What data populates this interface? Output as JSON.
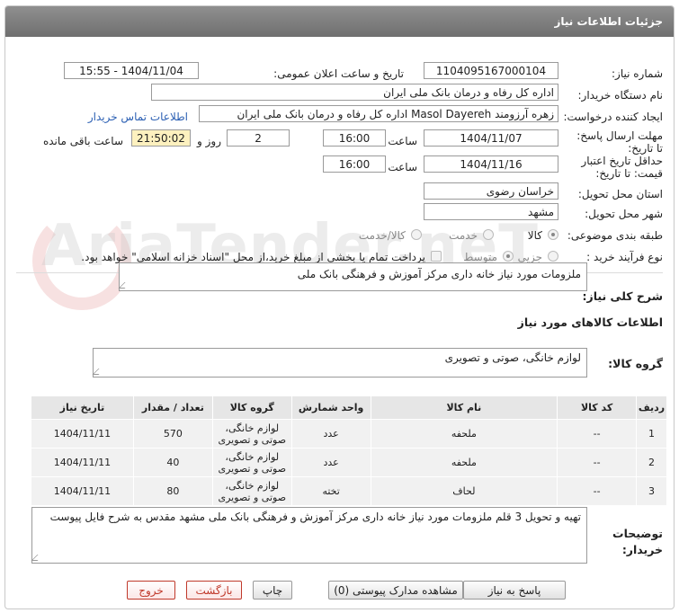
{
  "window": {
    "title": "جزئیات اطلاعات نیاز"
  },
  "watermark": {
    "text": "AriaTender.neT"
  },
  "form": {
    "need_number": {
      "label": "شماره نیاز:",
      "value": "1104095167000104"
    },
    "announce": {
      "label": "تاریخ و ساعت اعلان عمومی:",
      "value": "1404/11/04 - 15:55"
    },
    "buyer_org": {
      "label": "نام دستگاه خریدار:",
      "value": "اداره کل رفاه و درمان بانک ملی ایران"
    },
    "requester": {
      "label": "ایجاد کننده درخواست:",
      "value": "زهره آرزومند Masol Dayereh اداره کل رفاه و درمان بانک ملی ایران",
      "contact_link": "اطلاعات تماس خریدار"
    },
    "deadline": {
      "label": "مهلت ارسال پاسخ: تا تاریخ:",
      "date": "1404/11/07",
      "time_label": "ساعت",
      "time": "16:00",
      "days": "2",
      "days_label": "روز و",
      "remaining": "21:50:02",
      "remaining_label": "ساعت باقی مانده"
    },
    "validity": {
      "label": "حداقل تاریخ اعتبار قیمت: تا تاریخ:",
      "date": "1404/11/16",
      "time_label": "ساعت",
      "time": "16:00"
    },
    "province": {
      "label": "استان محل تحویل:",
      "value": "خراسان رضوی"
    },
    "city": {
      "label": "شهر محل تحویل:",
      "value": "مشهد"
    },
    "category": {
      "label": "طبقه بندی موضوعی:",
      "options": [
        "کالا",
        "خدمت",
        "کالا/خدمت"
      ],
      "selected": "کالا"
    },
    "purchase_type": {
      "label": "نوع فرآیند خرید :",
      "options": [
        "جزیی",
        "متوسط"
      ],
      "selected": "جزیی",
      "note": "پرداخت تمام یا بخشی از مبلغ خرید،از محل \"اسناد خزانه اسلامی\" خواهد بود."
    }
  },
  "summary": {
    "label": "شرح کلی نیاز:",
    "value": "ملزومات مورد نیاز خانه داری مرکز آموزش و فرهنگی بانک ملی"
  },
  "goods_section": {
    "title": "اطلاعات کالاهای مورد نیاز"
  },
  "goods_group": {
    "label": "گروه کالا:",
    "value": "لوازم خانگی، صوتی و تصویری"
  },
  "table": {
    "headers": [
      "ردیف",
      "کد کالا",
      "نام کالا",
      "واحد شمارش",
      "گروه کالا",
      "تعداد / مقدار",
      "تاریخ نیاز"
    ],
    "rows": [
      [
        "1",
        "--",
        "ملحفه",
        "عدد",
        "لوازم خانگی، صوتی و تصویری",
        "570",
        "1404/11/11"
      ],
      [
        "2",
        "--",
        "ملحفه",
        "عدد",
        "لوازم خانگی، صوتی و تصویری",
        "40",
        "1404/11/11"
      ],
      [
        "3",
        "--",
        "لحاف",
        "تخته",
        "لوازم خانگی، صوتی و تصویری",
        "80",
        "1404/11/11"
      ]
    ]
  },
  "buyer_notes": {
    "label": "توضیحات خریدار:",
    "value": "تهیه و تحویل 3 قلم ملزومات مورد نیاز خانه داری مرکز آموزش و فرهنگی بانک ملی مشهد مقدس به شرح فایل پیوست"
  },
  "buttons": {
    "reply": "پاسخ به نیاز",
    "attachments": "مشاهده مدارک پیوستی (0)",
    "print": "چاپ",
    "back": "بازگشت",
    "exit": "خروج"
  }
}
